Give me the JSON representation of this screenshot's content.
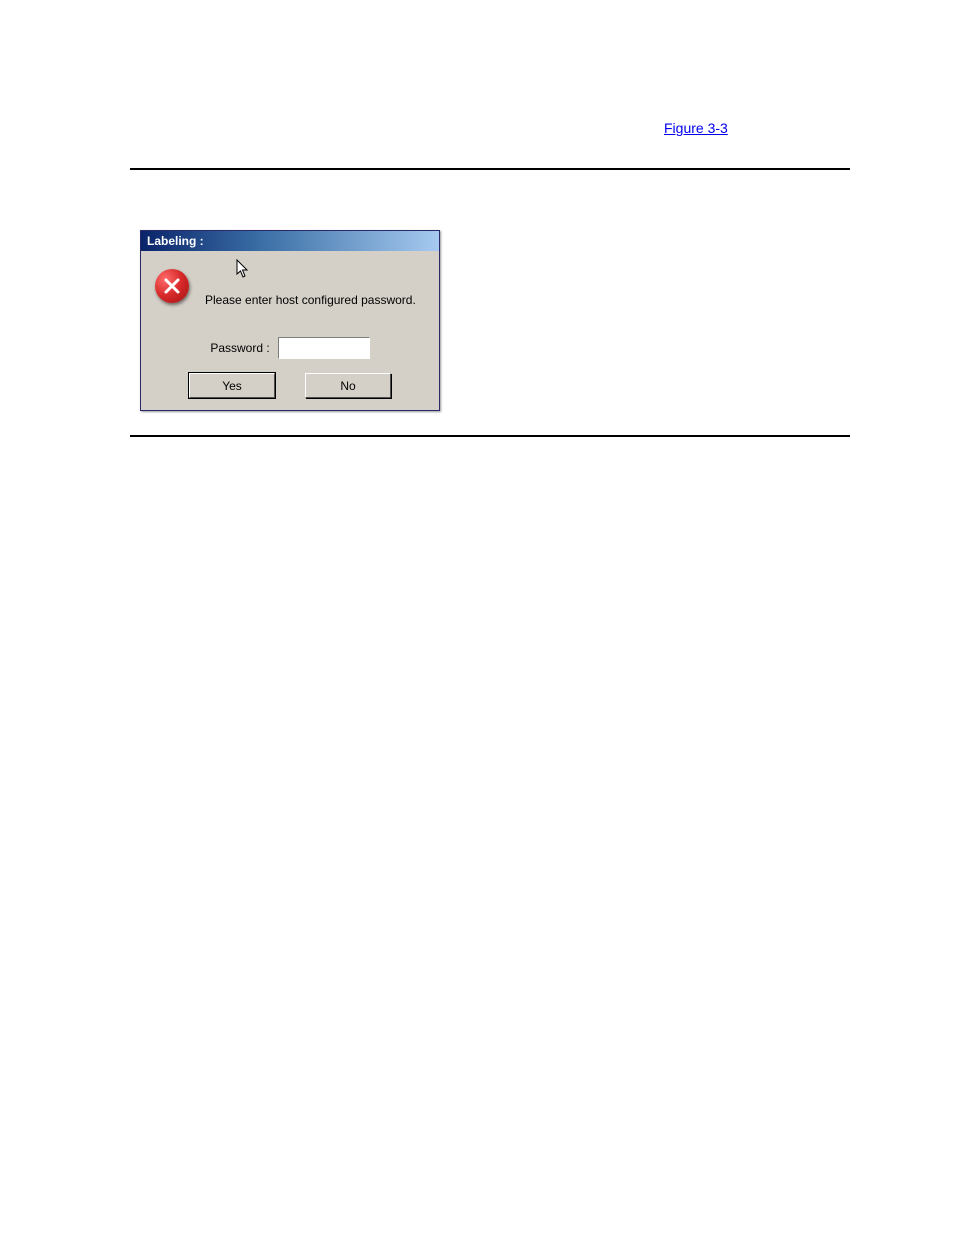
{
  "page": {
    "figure_ref": "Figure 3-3"
  },
  "dialog": {
    "title": "Labeling :",
    "message": "Please enter host configured password.",
    "password_label": "Password :",
    "password_value": "",
    "yes_label": "Yes",
    "no_label": "No"
  },
  "icons": {
    "error": "error-x-icon",
    "cursor": "cursor-arrow-icon"
  }
}
